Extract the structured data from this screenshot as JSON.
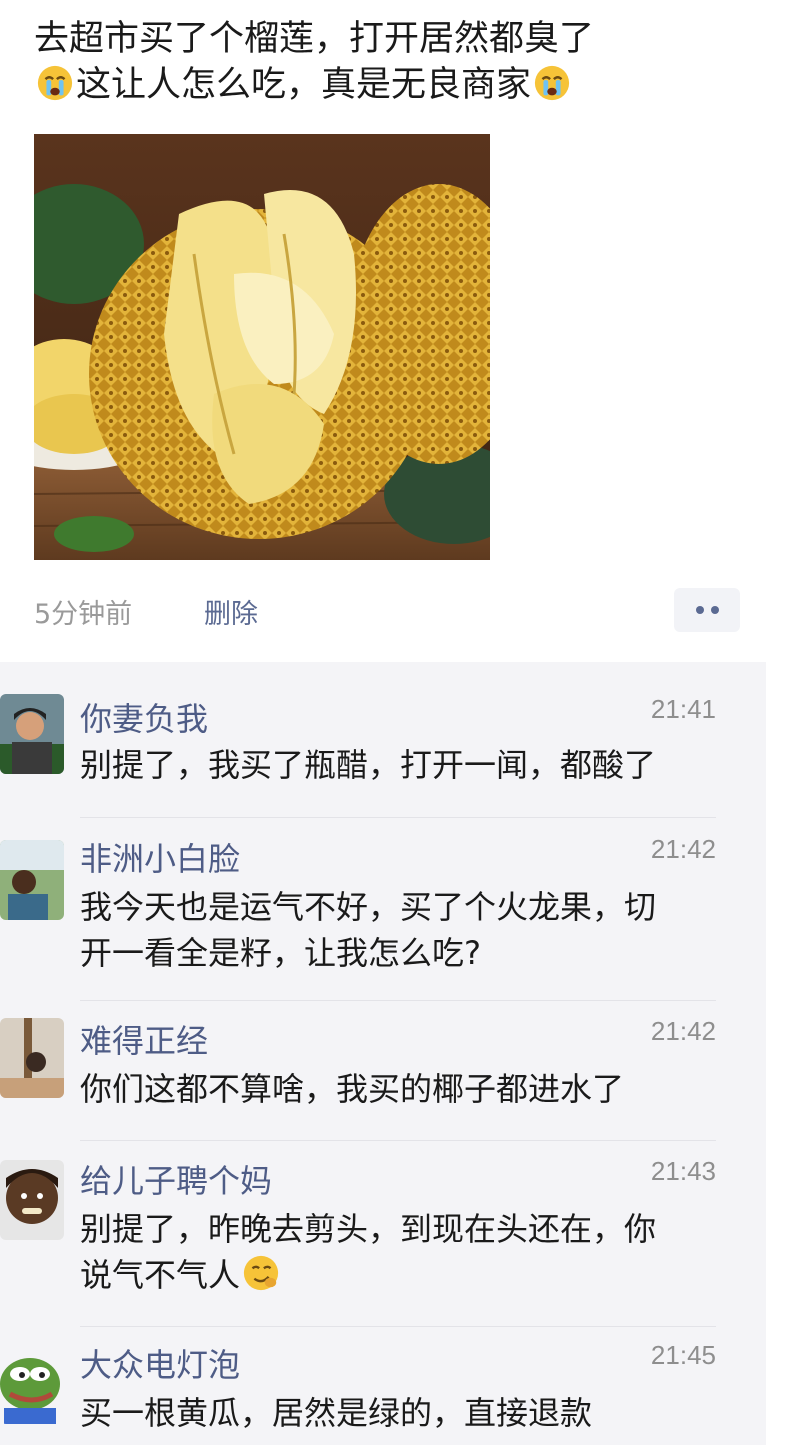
{
  "post": {
    "line1": "去超市买了个榴莲，打开居然都臭了",
    "line2": "这让人怎么吃，真是无良商家",
    "emoji": "crying-face",
    "image": "durian-photo",
    "time": "5分钟前",
    "delete_label": "删除",
    "more_icon": "more-dots-icon"
  },
  "comments": [
    {
      "name": "你妻负我",
      "time": "21:41",
      "lines": [
        "别提了，我买了瓶醋，打开一闻，都酸了"
      ]
    },
    {
      "name": "非洲小白脸",
      "time": "21:42",
      "lines": [
        "我今天也是运气不好，买了个火龙果，切",
        "开一看全是籽，让我怎么吃?"
      ]
    },
    {
      "name": "难得正经",
      "time": "21:42",
      "lines": [
        "你们这都不算啥，我买的椰子都进水了"
      ]
    },
    {
      "name": "给儿子聘个妈",
      "time": "21:43",
      "lines": [
        "别提了，昨晚去剪头，到现在头还在，你",
        "说气不气人"
      ],
      "emoji": "smirk-face"
    },
    {
      "name": "大众电灯泡",
      "time": "21:45",
      "lines": [
        "买一根黄瓜，居然是绿的，直接退款"
      ]
    }
  ],
  "colors": {
    "name_blue": "#4e5c86",
    "comment_bg": "#f4f4f7",
    "meta_gray": "#9a9a9a"
  }
}
